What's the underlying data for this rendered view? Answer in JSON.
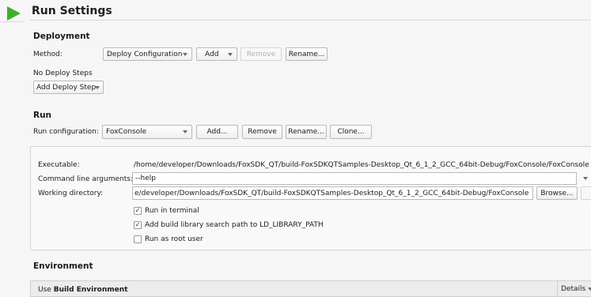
{
  "header": {
    "title": "Run Settings"
  },
  "deployment": {
    "heading": "Deployment",
    "method_label": "Method:",
    "method_value": "Deploy Configuration",
    "add_label": "Add",
    "remove_label": "Remove",
    "rename_label": "Rename...",
    "no_steps_text": "No Deploy Steps",
    "add_step_label": "Add Deploy Step"
  },
  "run": {
    "heading": "Run",
    "config_label": "Run configuration:",
    "config_value": "FoxConsole",
    "add_label": "Add...",
    "remove_label": "Remove",
    "rename_label": "Rename...",
    "clone_label": "Clone..."
  },
  "details": {
    "executable_label": "Executable:",
    "executable_value": "/home/developer/Downloads/FoxSDK_QT/build-FoxSDKQTSamples-Desktop_Qt_6_1_2_GCC_64bit-Debug/FoxConsole/FoxConsole",
    "args_label": "Command line arguments:",
    "args_value": "--help",
    "workdir_label": "Working directory:",
    "workdir_value": "e/developer/Downloads/FoxSDK_QT/build-FoxSDKQTSamples-Desktop_Qt_6_1_2_GCC_64bit-Debug/FoxConsole",
    "browse_label": "Browse...",
    "run_in_terminal": {
      "label": "Run in terminal",
      "checked": true
    },
    "add_build_lib": {
      "label": "Add build library search path to LD_LIBRARY_PATH",
      "checked": true
    },
    "run_as_root": {
      "label": "Run as root user",
      "checked": false
    }
  },
  "environment": {
    "heading": "Environment",
    "use_prefix": "Use",
    "use_bold": "Build Environment",
    "details_label": "Details"
  }
}
